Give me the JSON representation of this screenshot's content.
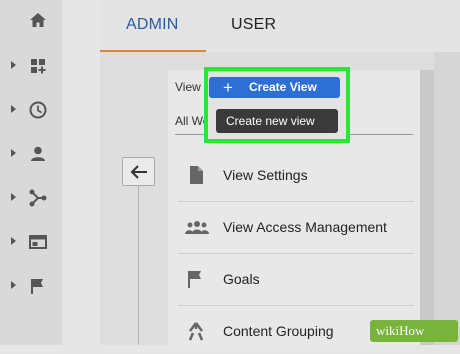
{
  "sidebar": {
    "items": [
      {
        "icon": "home-icon",
        "has_caret": false
      },
      {
        "icon": "dashboard-icon",
        "has_caret": true
      },
      {
        "icon": "clock-icon",
        "has_caret": true
      },
      {
        "icon": "person-icon",
        "has_caret": true
      },
      {
        "icon": "fork-icon",
        "has_caret": true
      },
      {
        "icon": "window-icon",
        "has_caret": true
      },
      {
        "icon": "flag-icon",
        "has_caret": true
      }
    ]
  },
  "tabs": {
    "admin": "ADMIN",
    "user": "USER",
    "active": "ADMIN"
  },
  "view_column": {
    "view_label": "View",
    "all_web_label": "All Web",
    "create_view_button": "Create View",
    "tooltip": "Create new view"
  },
  "menu": {
    "items": [
      {
        "label": "View Settings",
        "icon": "document-icon"
      },
      {
        "label": "View Access Management",
        "icon": "people-icon"
      },
      {
        "label": "Goals",
        "icon": "flag-icon"
      },
      {
        "label": "Content Grouping",
        "icon": "person-run-icon"
      }
    ]
  },
  "watermark": {
    "text": "wikiHow"
  },
  "colors": {
    "accent_blue": "#2e6fd3",
    "tab_active": "#2b5aa6",
    "tab_underline": "#d4883a",
    "highlight": "#2ee33a",
    "watermark": "#78b33c"
  }
}
